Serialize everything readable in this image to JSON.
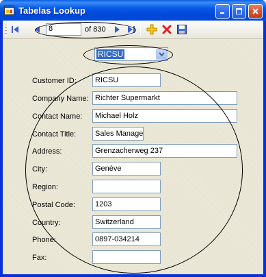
{
  "window": {
    "title": "Tabelas Lookup",
    "controls": {
      "minimize": "minimize",
      "maximize": "maximize",
      "close": "close"
    }
  },
  "navigator": {
    "position": "8",
    "count_label": "of 830",
    "icons": [
      "move-first-icon",
      "move-previous-icon",
      "move-next-icon",
      "move-last-icon",
      "add-new-icon",
      "delete-icon",
      "save-icon"
    ]
  },
  "lookup": {
    "selected": "RICSU"
  },
  "form": {
    "customer_id": {
      "label": "Customer ID:",
      "value": "RICSU"
    },
    "company_name": {
      "label": "Company Name:",
      "value": "Richter Supermarkt"
    },
    "contact_name": {
      "label": "Contact Name:",
      "value": "Michael Holz"
    },
    "contact_title": {
      "label": "Contact Title:",
      "value": "Sales Manage"
    },
    "address": {
      "label": "Address:",
      "value": "Grenzacherweg 237"
    },
    "city": {
      "label": "City:",
      "value": "Genève"
    },
    "region": {
      "label": "Region:",
      "value": ""
    },
    "postal_code": {
      "label": "Postal Code:",
      "value": "1203"
    },
    "country": {
      "label": "Country:",
      "value": "Switzerland"
    },
    "phone": {
      "label": "Phone:",
      "value": "0897-034214"
    },
    "fax": {
      "label": "Fax:",
      "value": ""
    }
  },
  "colors": {
    "titlebar": "#0054e3",
    "face": "#ece9d8",
    "selection": "#316ac5",
    "field_border": "#7f9db9"
  }
}
